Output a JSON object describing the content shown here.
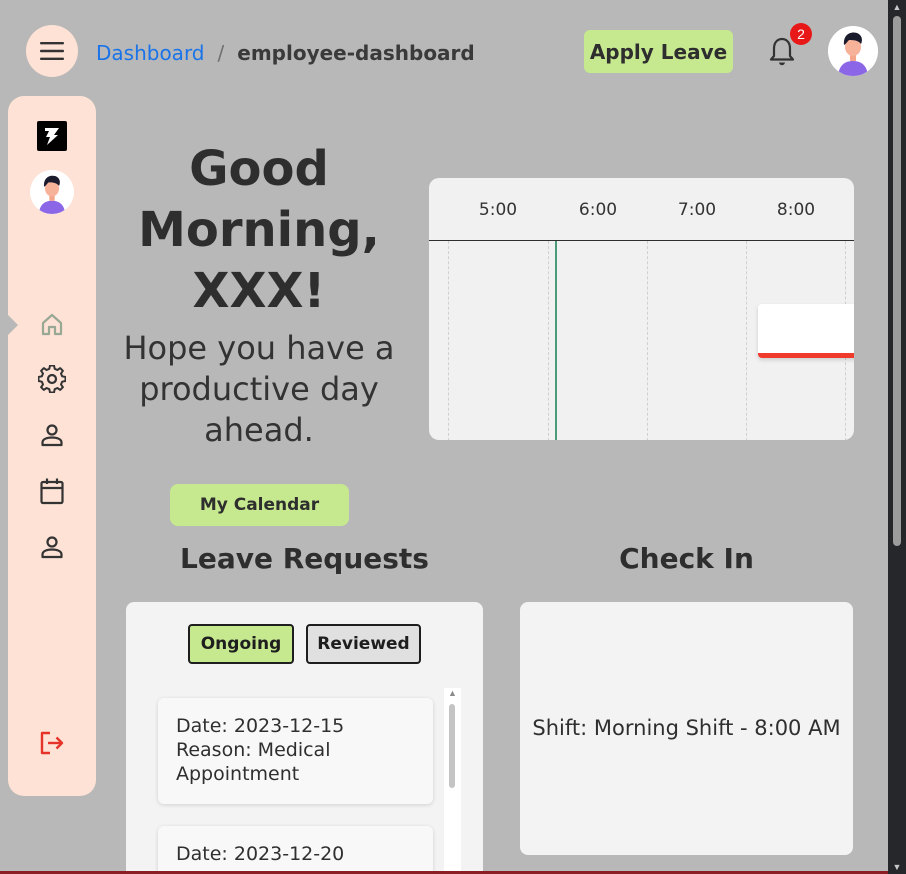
{
  "breadcrumb": {
    "link": "Dashboard",
    "separator": "/",
    "current": "employee-dashboard"
  },
  "header": {
    "apply_leave_label": "Apply Leave",
    "notification_count": "2"
  },
  "greeting": {
    "title_line1": "Good",
    "title_line2": "Morning,",
    "title_line3": "XXX!",
    "subtitle_line1": "Hope you have a",
    "subtitle_line2": "productive day",
    "subtitle_line3": "ahead.",
    "calendar_button": "My Calendar"
  },
  "timeline": {
    "hours": [
      "5:00",
      "6:00",
      "7:00",
      "8:00"
    ],
    "accent_color": "#f03a2c",
    "now_line_color": "#4a9a7c"
  },
  "leave_requests": {
    "title": "Leave Requests",
    "tabs": [
      "Ongoing",
      "Reviewed"
    ],
    "items": [
      {
        "date": "Date: 2023-12-15",
        "reason_line1": "Reason: Medical",
        "reason_line2": "Appointment"
      },
      {
        "date": "Date: 2023-12-20"
      }
    ]
  },
  "checkin": {
    "title": "Check In",
    "shift": "Shift: Morning Shift - 8:00 AM"
  },
  "sidebar": {
    "items": [
      "home-icon",
      "gear-icon",
      "person-icon",
      "calendar-icon",
      "person-icon",
      "logout-icon"
    ]
  },
  "colors": {
    "accent_green": "#c6e88f",
    "sidebar_bg": "#fde2d5",
    "link_blue": "#1a73e8",
    "badge_red": "#e81818"
  }
}
